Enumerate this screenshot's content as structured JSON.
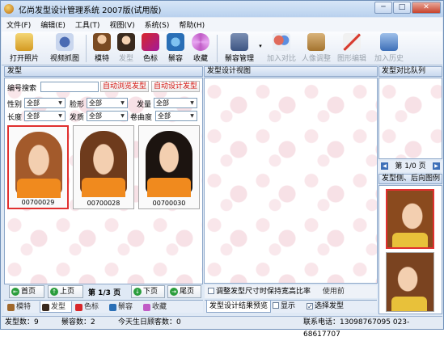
{
  "window": {
    "title": "亿尚发型设计管理系统 2007版(试用版)",
    "min_label": "─",
    "max_label": "□",
    "close_label": "✕"
  },
  "menu": [
    "文件(F)",
    "编辑(E)",
    "工具(T)",
    "视图(V)",
    "系统(S)",
    "帮助(H)"
  ],
  "toolbar": {
    "open_photo": "打开照片",
    "video_capture": "视频抓图",
    "model": "模特",
    "hairstyle": "发型",
    "color": "色标",
    "jewelry": "鬃容",
    "favorites": "收藏",
    "jewelry_manage": "鬃容管理",
    "add_compare": "加入对比",
    "portrait_adjust": "人像调整",
    "edit_graphic": "图形编辑",
    "add_history": "加入历史"
  },
  "left": {
    "header": "发型",
    "search_label": "编号搜索",
    "auto_browse": "自动浏览发型",
    "auto_design": "自动设计发型",
    "filters": [
      {
        "label": "性别",
        "value": "全部"
      },
      {
        "label": "脸形",
        "value": "全部"
      },
      {
        "label": "发量",
        "value": "全部"
      },
      {
        "label": "长度",
        "value": "全部"
      },
      {
        "label": "发质",
        "value": "全部"
      },
      {
        "label": "卷曲度",
        "value": "全部"
      }
    ],
    "thumbs": [
      {
        "code": "00700029"
      },
      {
        "code": "00700028"
      },
      {
        "code": "00700030"
      }
    ],
    "nav": {
      "first": "首页",
      "prev": "上页",
      "page": "第 1/3 页",
      "next": "下页",
      "last": "尾页"
    },
    "tabs": [
      "模特",
      "发型",
      "色标",
      "鬃容",
      "收藏"
    ]
  },
  "center": {
    "header": "发型设计视图",
    "adjust_label": "调整发型尺寸时保持宽高比率",
    "zoom_label": "使用前",
    "bottom_tab": "发型设计结果预览",
    "show_label": "显示",
    "select_label": "选择发型"
  },
  "right": {
    "header": "发型对比队列",
    "page": "第  1/0  页",
    "side_header": "发型侧、后向图例"
  },
  "status": {
    "hair_count": "发型数：9",
    "jewelry_count": "鬃容数：2",
    "birthday": "今天生日顾客数：0",
    "contact": "联系电话：13098767095 023-68617707"
  },
  "colors": {
    "title_bg": "#c9dcf2",
    "select_red": "#e0302f",
    "frame": "#8da7c9"
  }
}
